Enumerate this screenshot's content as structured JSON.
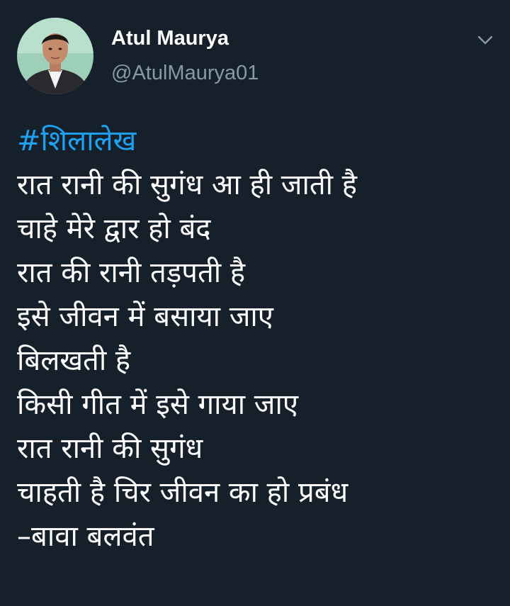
{
  "author": {
    "name": "Atul Maurya",
    "handle": "@AtulMaurya01"
  },
  "icons": {
    "more": "chevron-down-icon"
  },
  "colors": {
    "background": "#15202b",
    "text": "#ffffff",
    "secondary_text": "#8899a6",
    "link": "#1da1f2"
  },
  "tweet": {
    "hashtag": "#शिलालेख",
    "lines": [
      "रात रानी की सुगंध आ ही जाती है",
      "चाहे मेरे द्वार हो बंद",
      "रात की रानी तड़पती है",
      "इसे जीवन में बसाया जाए",
      "बिलखती है",
      "किसी गीत में इसे गाया जाए",
      "रात रानी की सुगंध",
      "चाहती है चिर जीवन का हो प्रबंध",
      "–बावा बलवंत"
    ]
  }
}
